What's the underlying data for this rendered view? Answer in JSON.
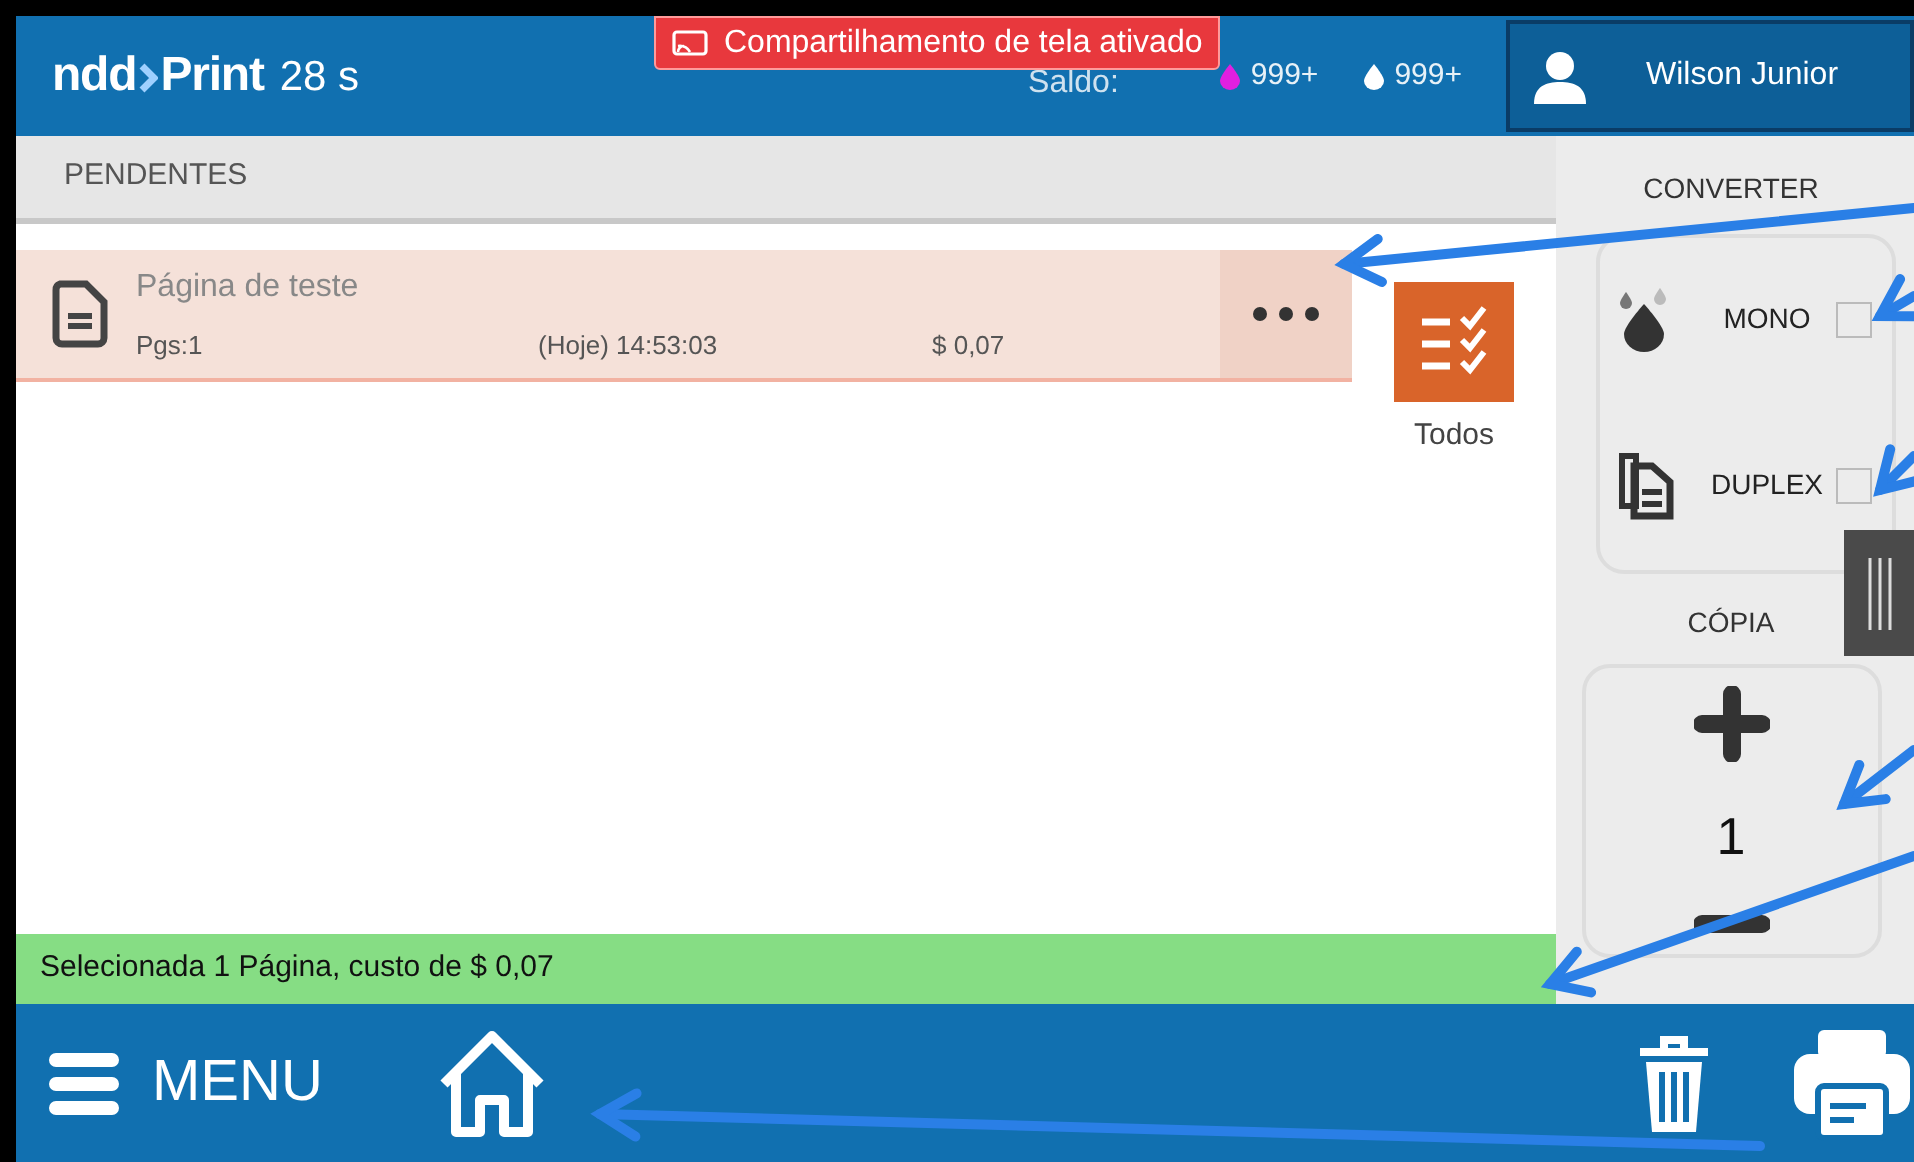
{
  "header": {
    "logo": "ndd",
    "logo_suffix": "Print",
    "timer": "28 s",
    "sharing_banner": "Compartilhamento de tela ativado",
    "balance_label": "Saldo:",
    "balances": [
      {
        "value": "999+",
        "color": "#e020e0"
      },
      {
        "value": "999+",
        "color": "#ffffff"
      }
    ],
    "user": "Wilson Junior"
  },
  "section_title": "PENDENTES",
  "jobs": [
    {
      "name": "Página de teste",
      "pages": "Pgs:1",
      "time": "(Hoje) 14:53:03",
      "cost": "$ 0,07",
      "selected": true
    }
  ],
  "select_all": {
    "label": "Todos"
  },
  "status": "Selecionada 1 Página, custo de $ 0,07",
  "panel": {
    "convert_title": "CONVERTER",
    "options": [
      {
        "kind": "mono",
        "label": "MONO",
        "checked": false
      },
      {
        "kind": "duplex",
        "label": "DUPLEX",
        "checked": false
      }
    ],
    "copies_title": "CÓPIA",
    "copies": "1"
  },
  "menu": {
    "label": "MENU"
  }
}
